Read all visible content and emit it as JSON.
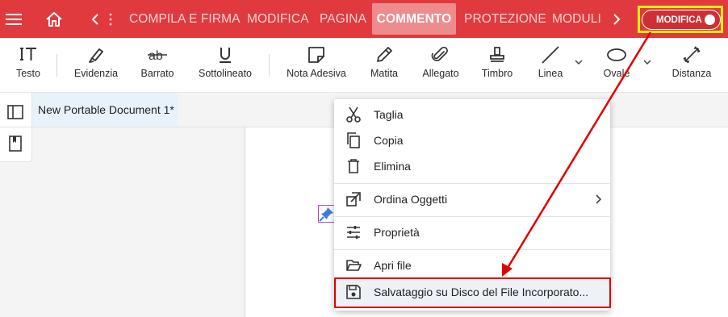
{
  "topbar": {
    "tabs": [
      {
        "label": "COMPILA E FIRMA"
      },
      {
        "label": "MODIFICA"
      },
      {
        "label": "PAGINA"
      },
      {
        "label": "COMMENTO"
      },
      {
        "label": "PROTEZIONE"
      },
      {
        "label": "MODULIS"
      }
    ],
    "mode_toggle_label": "MODIFICA",
    "color": "#e03a3e"
  },
  "toolbar": {
    "tools": [
      {
        "label": "Testo",
        "icon": "text-cursor-icon"
      },
      {
        "label": "Evidenzia",
        "icon": "highlighter-icon"
      },
      {
        "label": "Barrato",
        "icon": "strikethrough-icon"
      },
      {
        "label": "Sottolineato",
        "icon": "underline-icon"
      },
      {
        "label": "Nota Adesiva",
        "icon": "sticky-note-icon"
      },
      {
        "label": "Matita",
        "icon": "pencil-icon"
      },
      {
        "label": "Allegato",
        "icon": "paperclip-icon"
      },
      {
        "label": "Timbro",
        "icon": "stamp-icon"
      },
      {
        "label": "Linea",
        "icon": "line-icon"
      },
      {
        "label": "Ovale",
        "icon": "oval-icon"
      },
      {
        "label": "Distanza",
        "icon": "distance-icon"
      }
    ]
  },
  "document": {
    "tab_title": "New Portable Document 1*"
  },
  "context_menu": {
    "items": [
      {
        "label": "Taglia",
        "icon": "scissors-icon"
      },
      {
        "label": "Copia",
        "icon": "copy-icon"
      },
      {
        "label": "Elimina",
        "icon": "trash-icon"
      },
      {
        "label": "Ordina Oggetti",
        "icon": "arrange-icon"
      },
      {
        "label": "Proprietà",
        "icon": "sliders-icon"
      },
      {
        "label": "Apri file",
        "icon": "folder-open-icon"
      },
      {
        "label": "Salvataggio su Disco del File Incorporato...",
        "icon": "floppy-disk-icon"
      }
    ]
  },
  "annotation_color": "#e10000"
}
